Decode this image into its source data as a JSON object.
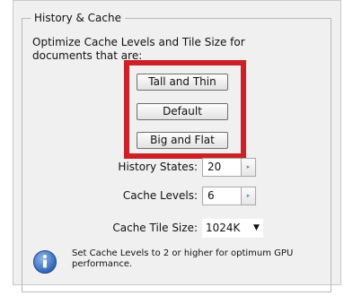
{
  "section": {
    "title": "History & Cache",
    "description": "Optimize Cache Levels and Tile Size for documents that are:"
  },
  "presets": {
    "tall_and_thin": "Tall and Thin",
    "default": "Default",
    "big_and_flat": "Big and Flat"
  },
  "fields": {
    "history_states": {
      "label": "History States:",
      "value": "20"
    },
    "cache_levels": {
      "label": "Cache Levels:",
      "value": "6"
    },
    "cache_tile_size": {
      "label": "Cache Tile Size:",
      "value": "1024K"
    }
  },
  "info": {
    "icon": "info-icon",
    "message": "Set Cache Levels to 2 or higher for optimum GPU performance."
  },
  "colors": {
    "highlight": "#cc2127",
    "info_icon": "#2a62b3"
  }
}
